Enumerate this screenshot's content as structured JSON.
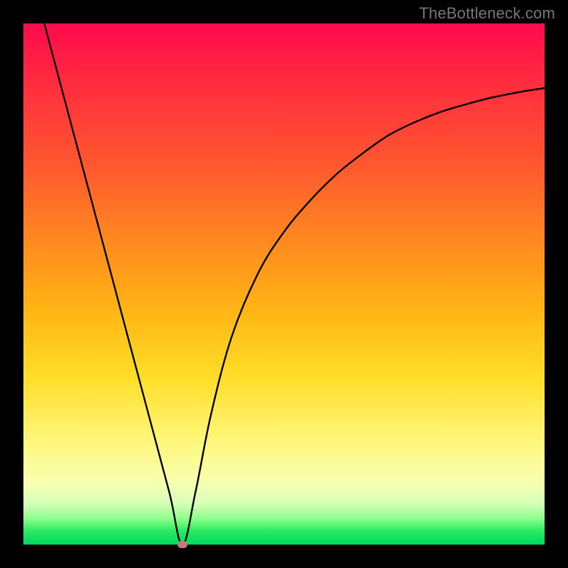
{
  "watermark": "TheBottleneck.com",
  "colors": {
    "frame": "#000000",
    "curve": "#000000",
    "marker": "#c97777",
    "gradient_top": "#ff0a4d",
    "gradient_bottom": "#00d860"
  },
  "chart_data": {
    "type": "line",
    "title": "",
    "xlabel": "",
    "ylabel": "",
    "xlim": [
      0,
      100
    ],
    "ylim": [
      0,
      100
    ],
    "grid": false,
    "legend": false,
    "series": [
      {
        "name": "bottleneck-curve",
        "x": [
          4,
          8,
          12,
          16,
          20,
          24,
          28,
          30.5,
          33,
          36,
          40,
          45,
          50,
          55,
          60,
          65,
          70,
          75,
          80,
          85,
          90,
          95,
          100
        ],
        "y": [
          100,
          85,
          70,
          55,
          40,
          25,
          10,
          0,
          10,
          25,
          40,
          52,
          60,
          66,
          71,
          75,
          78.5,
          81,
          83,
          84.5,
          85.8,
          86.8,
          87.6
        ]
      }
    ],
    "annotations": [
      {
        "type": "marker",
        "x": 30.5,
        "y": 0,
        "label": "optimal-point"
      }
    ]
  }
}
